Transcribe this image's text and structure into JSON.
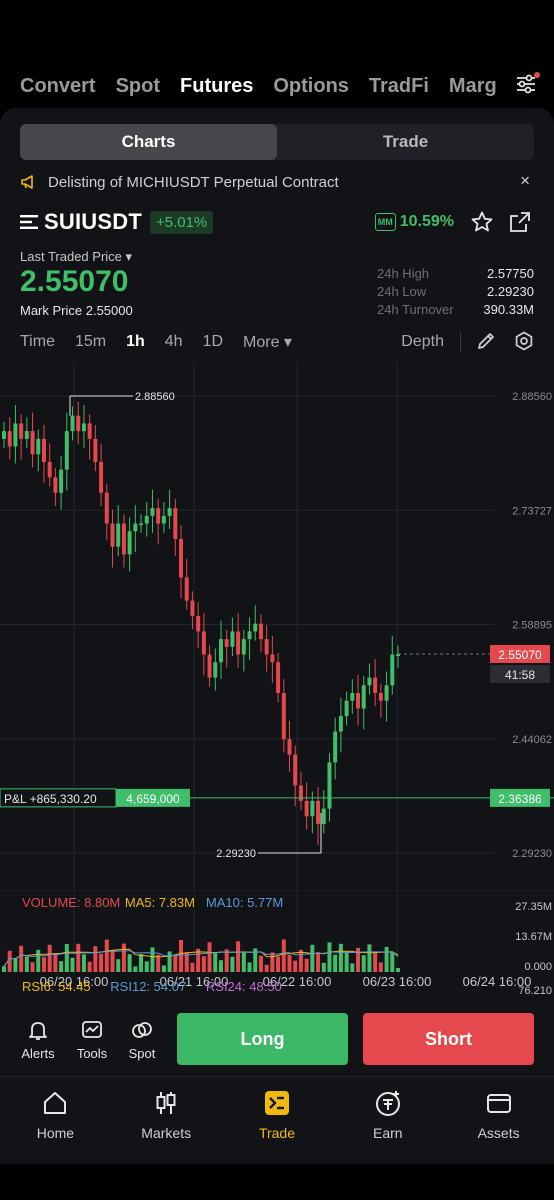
{
  "top_tabs": [
    "Convert",
    "Spot",
    "Futures",
    "Options",
    "TradFi",
    "Marg"
  ],
  "active_top_tab": "Futures",
  "segment": {
    "charts": "Charts",
    "trade": "Trade"
  },
  "notice": {
    "text": "Delisting  of MICHIUSDT Perpetual Contract",
    "close": "×"
  },
  "symbol": {
    "name": "SUIUSDT",
    "change": "+5.01%",
    "mm_label": "MM",
    "mm_value": "10.59%"
  },
  "price": {
    "ltp_label": "Last Traded Price ▾",
    "last": "2.55070",
    "mark": "Mark Price 2.55000"
  },
  "stats": [
    {
      "k": "24h High",
      "v": "2.57750"
    },
    {
      "k": "24h Low",
      "v": "2.29230"
    },
    {
      "k": "24h Turnover",
      "v": "390.33M"
    }
  ],
  "intervals": [
    "Time",
    "15m",
    "1h",
    "4h",
    "1D",
    "More ▾"
  ],
  "active_interval": "1h",
  "depth_label": "Depth",
  "chart_data": {
    "type": "candlestick",
    "y_ticks": [
      "2.88560",
      "2.73727",
      "2.58895",
      "2.44062",
      "2.29230"
    ],
    "x_ticks": [
      "06/20 16:00",
      "06/21 16:00",
      "06/22 16:00",
      "06/23 16:00",
      "06/24 16:00"
    ],
    "high_marker": "2.88560",
    "low_marker": "2.29230",
    "last_price_tag": "2.55070",
    "countdown": "41:58",
    "pnl_label": "P&L +865,330.20",
    "position_size": "4,659,000",
    "entry_price_tag": "2.36386",
    "closes": [
      2.84,
      2.82,
      2.85,
      2.83,
      2.84,
      2.81,
      2.83,
      2.8,
      2.78,
      2.76,
      2.79,
      2.84,
      2.86,
      2.84,
      2.85,
      2.83,
      2.8,
      2.76,
      2.72,
      2.69,
      2.72,
      2.68,
      2.71,
      2.72,
      2.72,
      2.73,
      2.74,
      2.72,
      2.73,
      2.74,
      2.7,
      2.65,
      2.62,
      2.6,
      2.58,
      2.55,
      2.52,
      2.54,
      2.57,
      2.56,
      2.58,
      2.55,
      2.57,
      2.58,
      2.59,
      2.57,
      2.55,
      2.54,
      2.5,
      2.44,
      2.42,
      2.38,
      2.36,
      2.34,
      2.36,
      2.33,
      2.35,
      2.41,
      2.45,
      2.47,
      2.49,
      2.5,
      2.48,
      2.51,
      2.52,
      2.5,
      2.49,
      2.51,
      2.55,
      2.55
    ],
    "volume": {
      "label": "VOLUME: 8.80M",
      "ma5": "MA5: 7.83M",
      "ma10": "MA10: 5.77M",
      "y_ticks": [
        "27.35M",
        "13.67M",
        "0.000"
      ]
    },
    "rsi": {
      "rsi6": "RSI6: 54.45",
      "rsi12": "RSI12: 54.07",
      "rsi24": "RSI24: 48.50",
      "y_tick": "76.210"
    },
    "colors": {
      "up": "#3fbf6a",
      "down": "#e5484d",
      "ma5": "#f0b90b",
      "ma10": "#5b9bd5",
      "rsi24": "#c46bd6"
    }
  },
  "tools": [
    {
      "label": "Alerts",
      "icon": "bell-icon"
    },
    {
      "label": "Tools",
      "icon": "tools-icon"
    },
    {
      "label": "Spot",
      "icon": "spot-icon"
    }
  ],
  "long_label": "Long",
  "short_label": "Short",
  "nav": [
    {
      "label": "Home",
      "icon": "home-icon"
    },
    {
      "label": "Markets",
      "icon": "markets-icon"
    },
    {
      "label": "Trade",
      "icon": "trade-icon"
    },
    {
      "label": "Earn",
      "icon": "earn-icon"
    },
    {
      "label": "Assets",
      "icon": "wallet-icon"
    }
  ],
  "active_nav": "Trade"
}
